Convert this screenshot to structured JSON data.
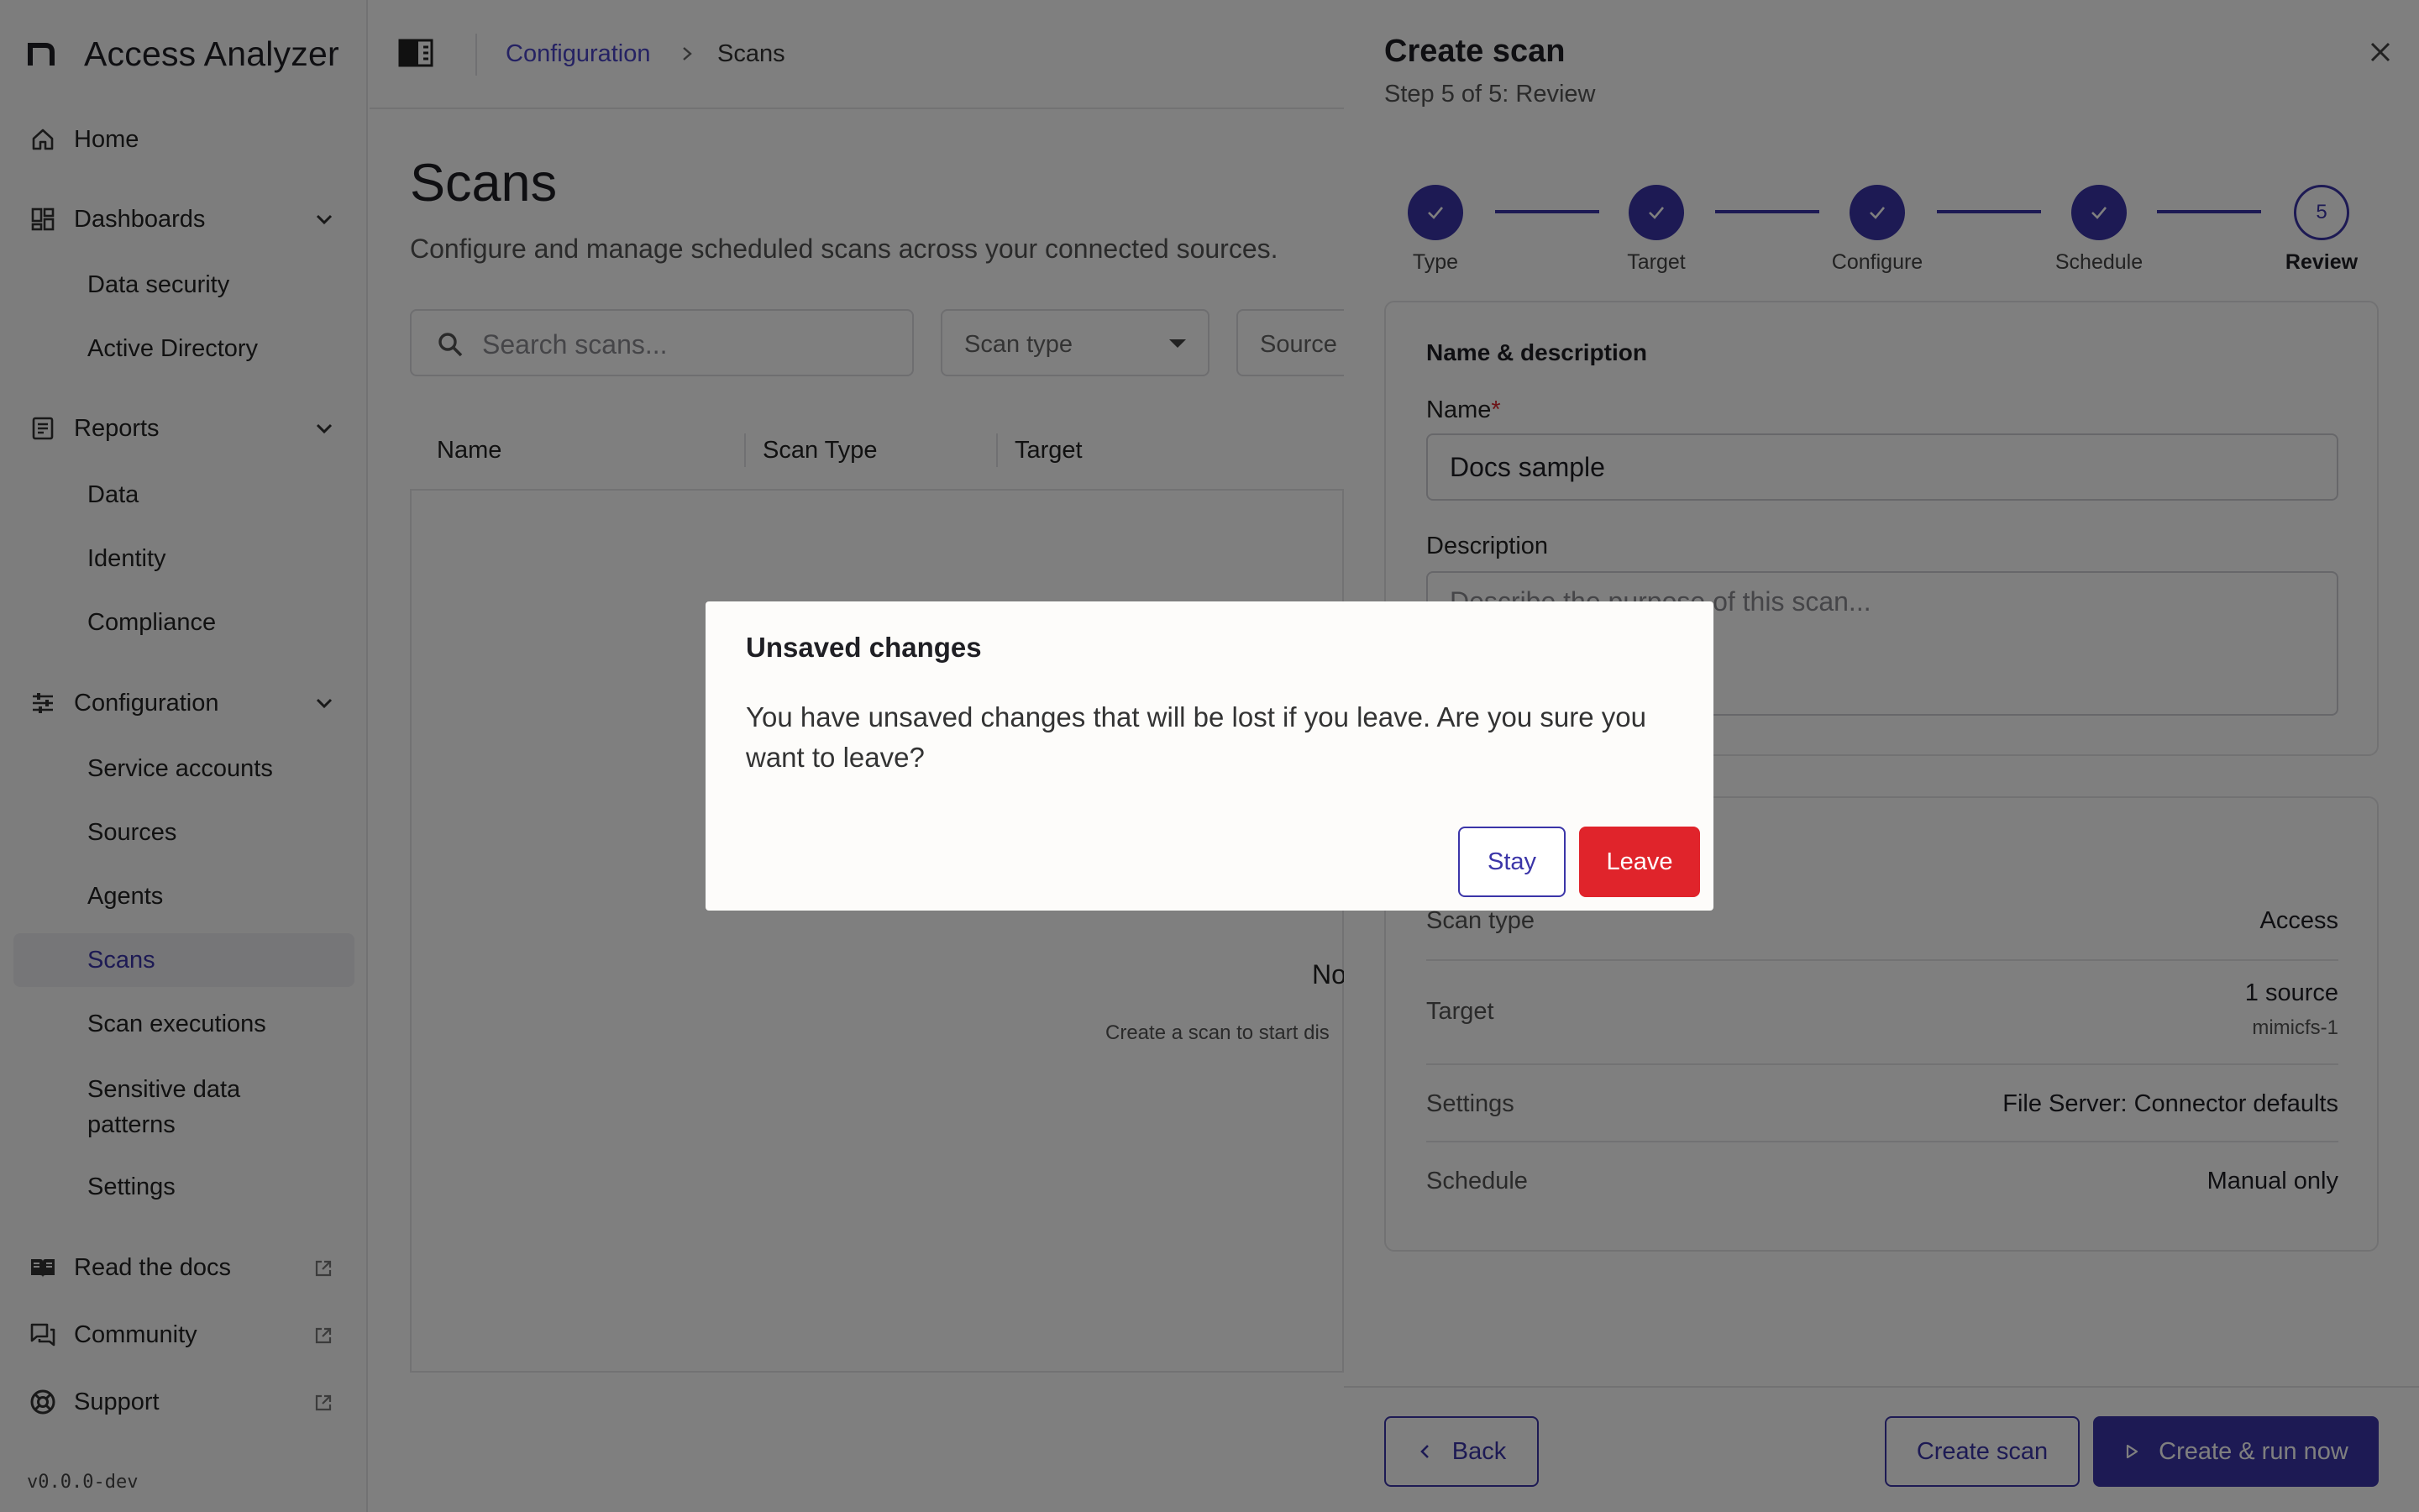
{
  "app": {
    "title": "Access Analyzer",
    "version": "v0.0.0-dev"
  },
  "sidebar": {
    "home": "Home",
    "dashboards": {
      "label": "Dashboards",
      "items": [
        "Data security",
        "Active Directory"
      ]
    },
    "reports": {
      "label": "Reports",
      "items": [
        "Data",
        "Identity",
        "Compliance"
      ]
    },
    "configuration": {
      "label": "Configuration",
      "items": [
        "Service accounts",
        "Sources",
        "Agents",
        "Scans",
        "Scan executions",
        "Sensitive data patterns",
        "Settings"
      ],
      "active": "Scans"
    },
    "links": [
      "Read the docs",
      "Community",
      "Support"
    ]
  },
  "breadcrumb": {
    "parent": "Configuration",
    "current": "Scans"
  },
  "page": {
    "title": "Scans",
    "subtitle": "Configure and manage scheduled scans across your connected sources.",
    "search_placeholder": "Search scans...",
    "filter_scan_type": "Scan type",
    "filter_source": "Source",
    "columns": [
      "Name",
      "Scan Type",
      "Target"
    ],
    "empty_title": "No",
    "empty_sub": "Create a scan to start dis"
  },
  "drawer": {
    "title": "Create scan",
    "subtitle": "Step 5 of 5: Review",
    "steps": [
      {
        "label": "Type",
        "state": "done"
      },
      {
        "label": "Target",
        "state": "done"
      },
      {
        "label": "Configure",
        "state": "done"
      },
      {
        "label": "Schedule",
        "state": "done"
      },
      {
        "label": "Review",
        "state": "current",
        "number": "5"
      }
    ],
    "name_section": {
      "heading": "Name & description",
      "name_label": "Name",
      "required_mark": "*",
      "name_value": "Docs sample",
      "description_label": "Description",
      "description_placeholder": "Describe the purpose of this scan..."
    },
    "review": {
      "rows": [
        {
          "key": "Scan type",
          "value": "Access"
        },
        {
          "key": "Target",
          "value": "1 source",
          "detail": "mimicfs-1"
        },
        {
          "key": "Settings",
          "value": "File Server: Connector defaults"
        },
        {
          "key": "Schedule",
          "value": "Manual only"
        }
      ]
    },
    "footer": {
      "back": "Back",
      "create": "Create scan",
      "create_run": "Create & run now"
    }
  },
  "modal": {
    "title": "Unsaved changes",
    "body": "You have unsaved changes that will be lost if you leave. Are you sure you want to leave?",
    "stay": "Stay",
    "leave": "Leave"
  },
  "colors": {
    "accent": "#3b35a8",
    "danger": "#e0242b",
    "overlay": "rgba(0,0,0,0.5)"
  }
}
